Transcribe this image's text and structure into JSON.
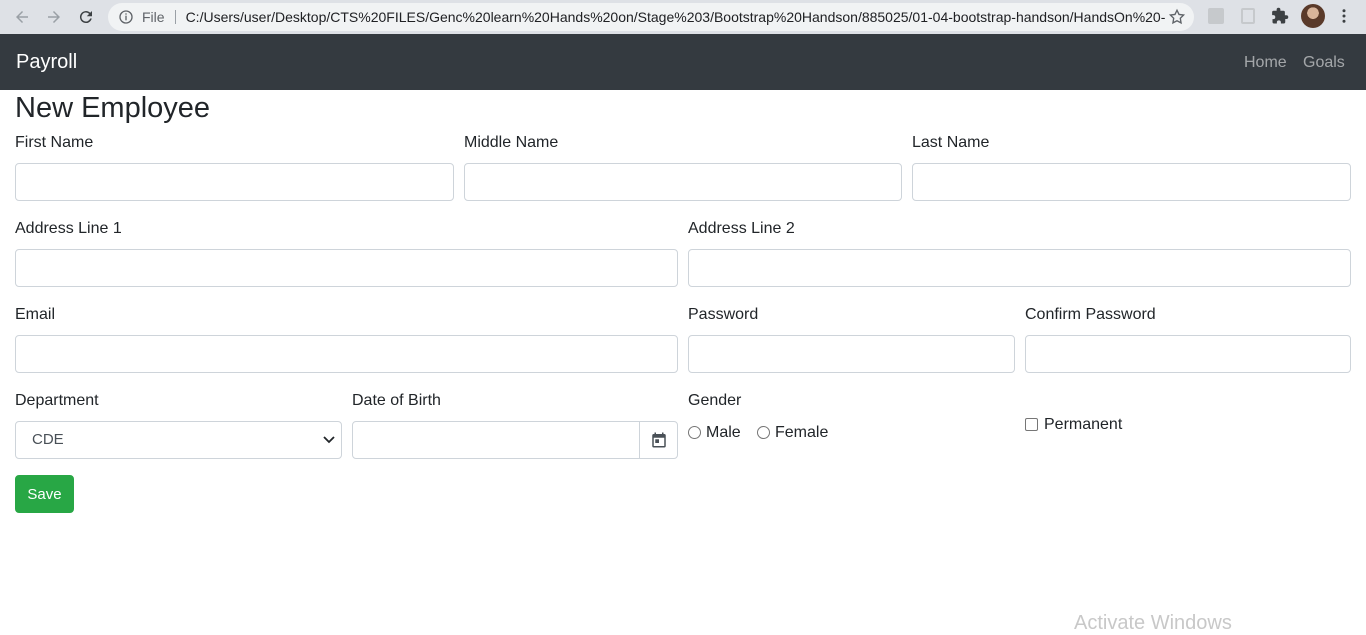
{
  "browser": {
    "scheme_label": "File",
    "url": "C:/Users/user/Desktop/CTS%20FILES/Genc%20learn%20Hands%20on/Stage%203/Bootstrap%20Handson/885025/01-04-bootstrap-handson/HandsOn%20-..."
  },
  "navbar": {
    "brand": "Payroll",
    "links": [
      "Home",
      "Goals"
    ]
  },
  "form": {
    "title": "New Employee",
    "first_name_label": "First Name",
    "middle_name_label": "Middle Name",
    "last_name_label": "Last Name",
    "address1_label": "Address Line 1",
    "address2_label": "Address Line 2",
    "email_label": "Email",
    "password_label": "Password",
    "confirm_password_label": "Confirm Password",
    "department_label": "Department",
    "department_value": "CDE",
    "dob_label": "Date of Birth",
    "gender_label": "Gender",
    "gender_options": [
      "Male",
      "Female"
    ],
    "permanent_label": "Permanent",
    "save_label": "Save"
  },
  "watermark": "Activate Windows",
  "colors": {
    "navbar_bg": "#343a40",
    "save_bg": "#28a745",
    "chrome_bg": "#dee1e6"
  },
  "icons": [
    "back-arrow-icon",
    "forward-arrow-icon",
    "reload-icon",
    "info-icon",
    "star-icon",
    "extensions-icon",
    "menu-dots-icon",
    "calendar-icon",
    "chevron-down-icon"
  ]
}
